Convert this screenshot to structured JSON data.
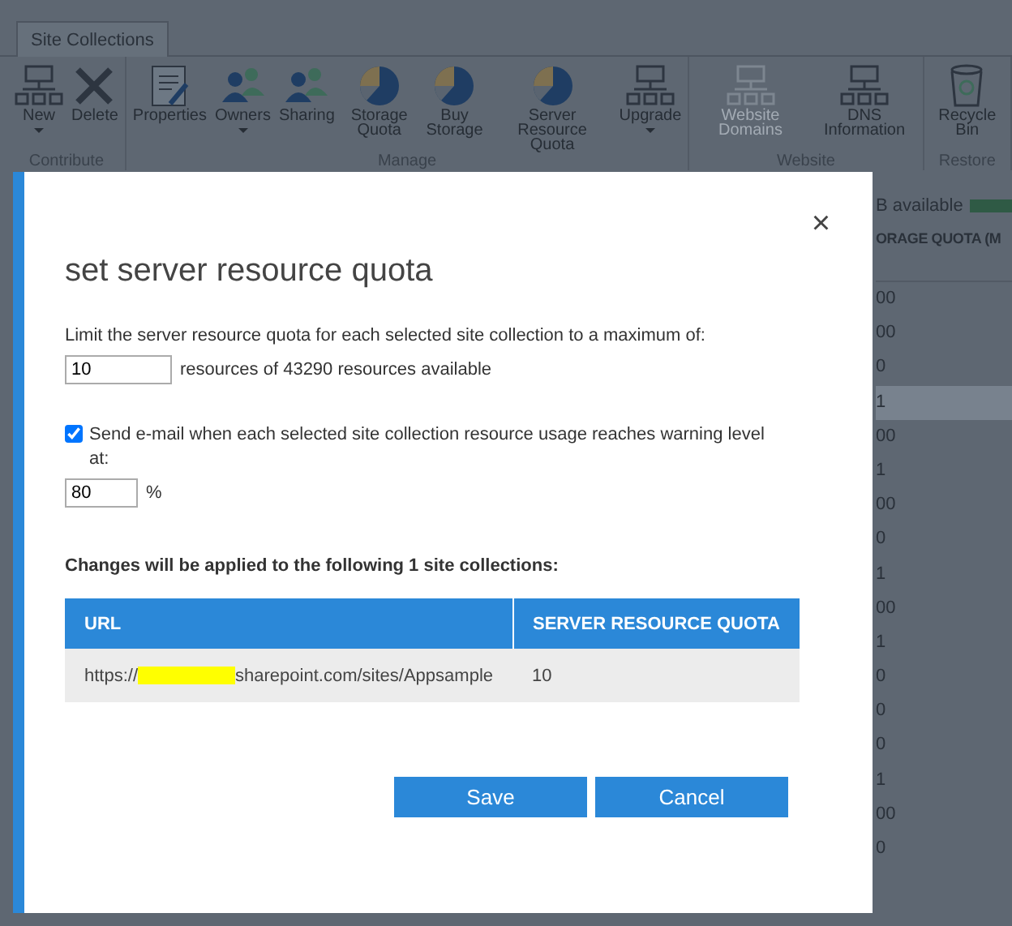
{
  "ribbon": {
    "tab": {
      "label": "Site Collections"
    },
    "groups": [
      {
        "label": "Contribute",
        "buttons": [
          {
            "label": "New",
            "kind": "sitemap",
            "dropdown": true,
            "disabled": false
          },
          {
            "label": "Delete",
            "kind": "delete",
            "dropdown": false,
            "disabled": false
          }
        ]
      },
      {
        "label": "Manage",
        "buttons": [
          {
            "label": "Properties",
            "kind": "document",
            "dropdown": false,
            "disabled": false
          },
          {
            "label": "Owners",
            "kind": "people",
            "dropdown": true,
            "disabled": false
          },
          {
            "label": "Sharing",
            "kind": "people",
            "dropdown": false,
            "disabled": false
          },
          {
            "label": "Storage Quota",
            "kind": "pie",
            "dropdown": false,
            "disabled": false
          },
          {
            "label": "Buy Storage",
            "kind": "pie",
            "dropdown": false,
            "disabled": false
          },
          {
            "label": "Server Resource Quota",
            "kind": "pie",
            "dropdown": false,
            "disabled": false
          },
          {
            "label": "Upgrade",
            "kind": "sitemap",
            "dropdown": true,
            "disabled": false
          }
        ]
      },
      {
        "label": "Website",
        "buttons": [
          {
            "label": "Website Domains",
            "kind": "sitemap",
            "dropdown": false,
            "disabled": true
          },
          {
            "label": "DNS Information",
            "kind": "sitemap",
            "dropdown": false,
            "disabled": false
          }
        ]
      },
      {
        "label": "Restore",
        "buttons": [
          {
            "label": "Recycle Bin",
            "kind": "bin",
            "dropdown": false,
            "disabled": false
          }
        ]
      }
    ]
  },
  "background_list": {
    "available": "B available",
    "column_header": "ORAGE QUOTA (M",
    "rows": [
      {
        "text": "00",
        "selected": false
      },
      {
        "text": "00",
        "selected": false
      },
      {
        "text": "0",
        "selected": false
      },
      {
        "text": "1",
        "selected": true
      },
      {
        "text": "00",
        "selected": false
      },
      {
        "text": "1",
        "selected": false
      },
      {
        "text": "00",
        "selected": false
      },
      {
        "text": "0",
        "selected": false
      },
      {
        "text": "1",
        "selected": false
      },
      {
        "text": "00",
        "selected": false
      },
      {
        "text": "1",
        "selected": false
      },
      {
        "text": "0",
        "selected": false
      },
      {
        "text": "0",
        "selected": false
      },
      {
        "text": "0",
        "selected": false
      },
      {
        "text": "1",
        "selected": false
      },
      {
        "text": "00",
        "selected": false
      },
      {
        "text": "0",
        "selected": false
      }
    ]
  },
  "dialog": {
    "close": "×",
    "title": "set server resource quota",
    "limit_text": "Limit the server resource quota for each selected site collection to a maximum of:",
    "limit_value": "10",
    "limit_suffix": "resources of 43290 resources available",
    "email_warning": {
      "label": "Send e-mail when each selected site collection resource usage reaches warning level at:",
      "checked": true
    },
    "warning_value": "80",
    "warning_suffix": "%",
    "changes_heading": "Changes will be applied to the following 1 site collections:",
    "table": {
      "columns": [
        "URL",
        "SERVER RESOURCE QUOTA"
      ],
      "rows": [
        {
          "url_start": "https://",
          "url_end": "sharepoint.com/sites/Appsample",
          "quota": "10"
        }
      ]
    },
    "buttons": [
      "Save",
      "Cancel"
    ]
  }
}
